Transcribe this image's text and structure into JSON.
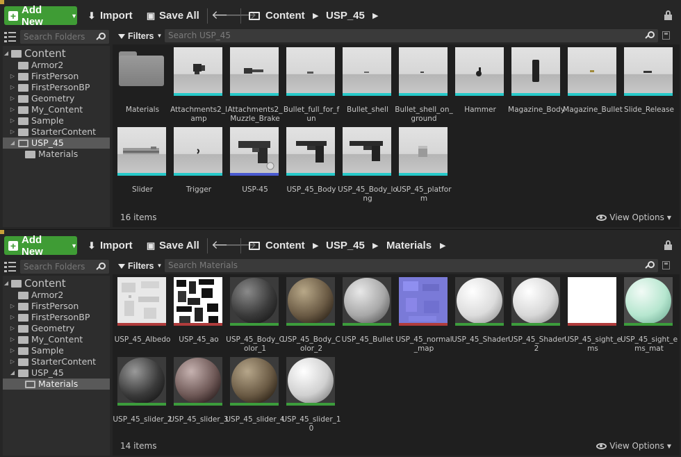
{
  "colors": {
    "add_green": "#3f9c35",
    "mesh_bar": "#26c9c9",
    "tex_bar": "#b03c3c",
    "mat_bar": "#3c9c3c",
    "skel_bar": "#4a5ad0",
    "selected_row": "#595959"
  },
  "toolbar": {
    "add_new": "Add New",
    "import": "Import",
    "save_all": "Save All"
  },
  "panels": [
    {
      "breadcrumbs": [
        "Content",
        "USP_45"
      ],
      "sidebar": {
        "search_placeholder": "Search Folders",
        "tree": [
          {
            "label": "Content",
            "level": 0,
            "expanded": true
          },
          {
            "label": "Armor2",
            "level": 1
          },
          {
            "label": "FirstPerson",
            "level": 1,
            "has_children": true
          },
          {
            "label": "FirstPersonBP",
            "level": 1,
            "has_children": true
          },
          {
            "label": "Geometry",
            "level": 1,
            "has_children": true
          },
          {
            "label": "My_Content",
            "level": 1,
            "has_children": true
          },
          {
            "label": "Sample",
            "level": 1,
            "has_children": true
          },
          {
            "label": "StarterContent",
            "level": 1,
            "has_children": true
          },
          {
            "label": "USP_45",
            "level": 1,
            "expanded": true,
            "selected": true
          },
          {
            "label": "Materials",
            "level": 2
          }
        ]
      },
      "filters_label": "Filters",
      "search_placeholder": "Search USP_45",
      "assets": [
        {
          "name": "Materials",
          "kind": "folder"
        },
        {
          "name": "Attachments2_lamp",
          "kind": "mesh",
          "icon": "lamp-mesh"
        },
        {
          "name": "Attachments2_Muzzle_Brake",
          "kind": "mesh",
          "icon": "muzzle-mesh"
        },
        {
          "name": "Bullet_full_for_fun",
          "kind": "mesh",
          "icon": "bullet-mesh"
        },
        {
          "name": "Bullet_shell",
          "kind": "mesh",
          "icon": "shell-mesh"
        },
        {
          "name": "Bullet_shell_on_ground",
          "kind": "mesh",
          "icon": "shell-mesh"
        },
        {
          "name": "Hammer",
          "kind": "mesh",
          "icon": "hammer-mesh"
        },
        {
          "name": "Magazine_Body",
          "kind": "mesh",
          "icon": "magazine-mesh"
        },
        {
          "name": "Magazine_Bullet",
          "kind": "mesh",
          "icon": "bullet-mesh"
        },
        {
          "name": "Slide_Release",
          "kind": "mesh",
          "icon": "slide-release-mesh"
        },
        {
          "name": "Slider",
          "kind": "mesh",
          "icon": "slider-mesh"
        },
        {
          "name": "Trigger",
          "kind": "mesh",
          "icon": "trigger-mesh"
        },
        {
          "name": "USP-45",
          "kind": "skeletal",
          "icon": "pistol-mesh"
        },
        {
          "name": "USP_45_Body",
          "kind": "mesh",
          "icon": "pistol-mesh"
        },
        {
          "name": "USP_45_Body_long",
          "kind": "mesh",
          "icon": "pistol-mesh"
        },
        {
          "name": "USP_45_platform",
          "kind": "mesh",
          "icon": "platform-mesh"
        }
      ],
      "item_count": "16 items",
      "view_options": "View Options"
    },
    {
      "breadcrumbs": [
        "Content",
        "USP_45",
        "Materials"
      ],
      "sidebar": {
        "search_placeholder": "Search Folders",
        "tree": [
          {
            "label": "Content",
            "level": 0,
            "expanded": true
          },
          {
            "label": "Armor2",
            "level": 1
          },
          {
            "label": "FirstPerson",
            "level": 1,
            "has_children": true
          },
          {
            "label": "FirstPersonBP",
            "level": 1,
            "has_children": true
          },
          {
            "label": "Geometry",
            "level": 1,
            "has_children": true
          },
          {
            "label": "My_Content",
            "level": 1,
            "has_children": true
          },
          {
            "label": "Sample",
            "level": 1,
            "has_children": true
          },
          {
            "label": "StarterContent",
            "level": 1,
            "has_children": true
          },
          {
            "label": "USP_45",
            "level": 1,
            "expanded": true
          },
          {
            "label": "Materials",
            "level": 2,
            "selected": true
          }
        ]
      },
      "filters_label": "Filters",
      "search_placeholder": "Search Materials",
      "assets": [
        {
          "name": "USP_45_Albedo",
          "kind": "texture",
          "icon": "albedo-texture"
        },
        {
          "name": "USP_45_ao",
          "kind": "texture",
          "icon": "ao-texture"
        },
        {
          "name": "USP_45_Body_Color_1",
          "kind": "material",
          "icon": "dark-metal-sphere"
        },
        {
          "name": "USP_45_Body_Color_2",
          "kind": "material",
          "icon": "brown-metal-sphere"
        },
        {
          "name": "USP_45_Bullet",
          "kind": "material",
          "icon": "silver-sphere"
        },
        {
          "name": "USP_45_normal_map",
          "kind": "texture",
          "icon": "normal-map-texture"
        },
        {
          "name": "USP_45_Shader",
          "kind": "material",
          "icon": "white-sphere"
        },
        {
          "name": "USP_45_Shader2",
          "kind": "material",
          "icon": "white-sphere"
        },
        {
          "name": "USP_45_sight_ems",
          "kind": "texture",
          "icon": "white-texture"
        },
        {
          "name": "USP_45_sight_ems_mat",
          "kind": "material",
          "icon": "mint-sphere"
        },
        {
          "name": "USP_45_slider_2",
          "kind": "material",
          "icon": "dark-metal-sphere"
        },
        {
          "name": "USP_45_slider_3",
          "kind": "material",
          "icon": "rose-metal-sphere"
        },
        {
          "name": "USP_45_slider_4",
          "kind": "material",
          "icon": "brown-metal-sphere"
        },
        {
          "name": "USP_45_slider_10",
          "kind": "material",
          "icon": "white-sphere"
        }
      ],
      "item_count": "14 items",
      "view_options": "View Options"
    }
  ]
}
